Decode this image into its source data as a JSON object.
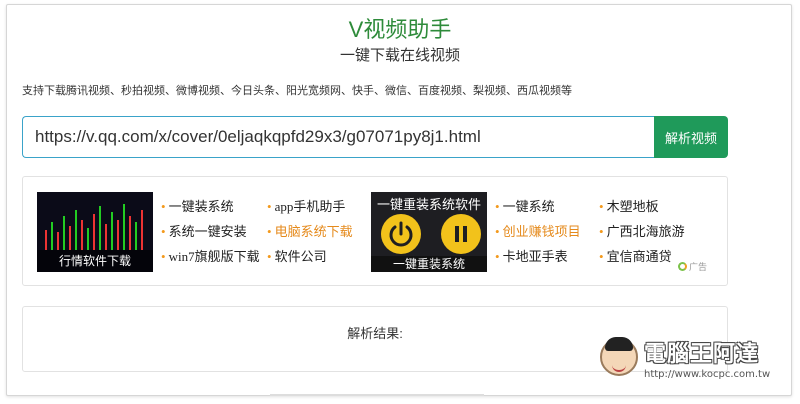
{
  "header": {
    "title": "V视频助手",
    "subtitle": "一键下载在线视频"
  },
  "support_text": "支持下载腾讯视频、秒拍视频、微博视频、今日头条、阳光宽频网、快手、微信、百度视频、梨视频、西瓜视频等",
  "url_bar": {
    "value": "https://v.qq.com/x/cover/0eljaqkqpfd29x3/g07071py8j1.html",
    "button_label": "解析视频"
  },
  "ads": {
    "image_left_caption": "行情软件下载",
    "image_right_top": "一键重装系统软件",
    "image_right_bottom": "一键重装系统",
    "col1": [
      "一键装系统",
      "系统一键安装",
      "win7旗舰版下载"
    ],
    "col2": [
      "app手机助手",
      "电脑系统下载",
      "软件公司"
    ],
    "col3": [
      "一键系统",
      "创业赚钱项目",
      "卡地亚手表"
    ],
    "col4": [
      "木塑地板",
      "广西北海旅游",
      "宜信商通贷"
    ],
    "badge": "广告",
    "colors": {
      "bullet": "#f39a1e",
      "highlight": "#e58a1c"
    }
  },
  "result": {
    "label": "解析结果:"
  },
  "watermark": {
    "title": "電腦王阿達",
    "url": "http://www.kocpc.com.tw"
  },
  "colors": {
    "title": "#2e8b3a",
    "button": "#1f9a5a",
    "input_border": "#3aa3c9"
  }
}
